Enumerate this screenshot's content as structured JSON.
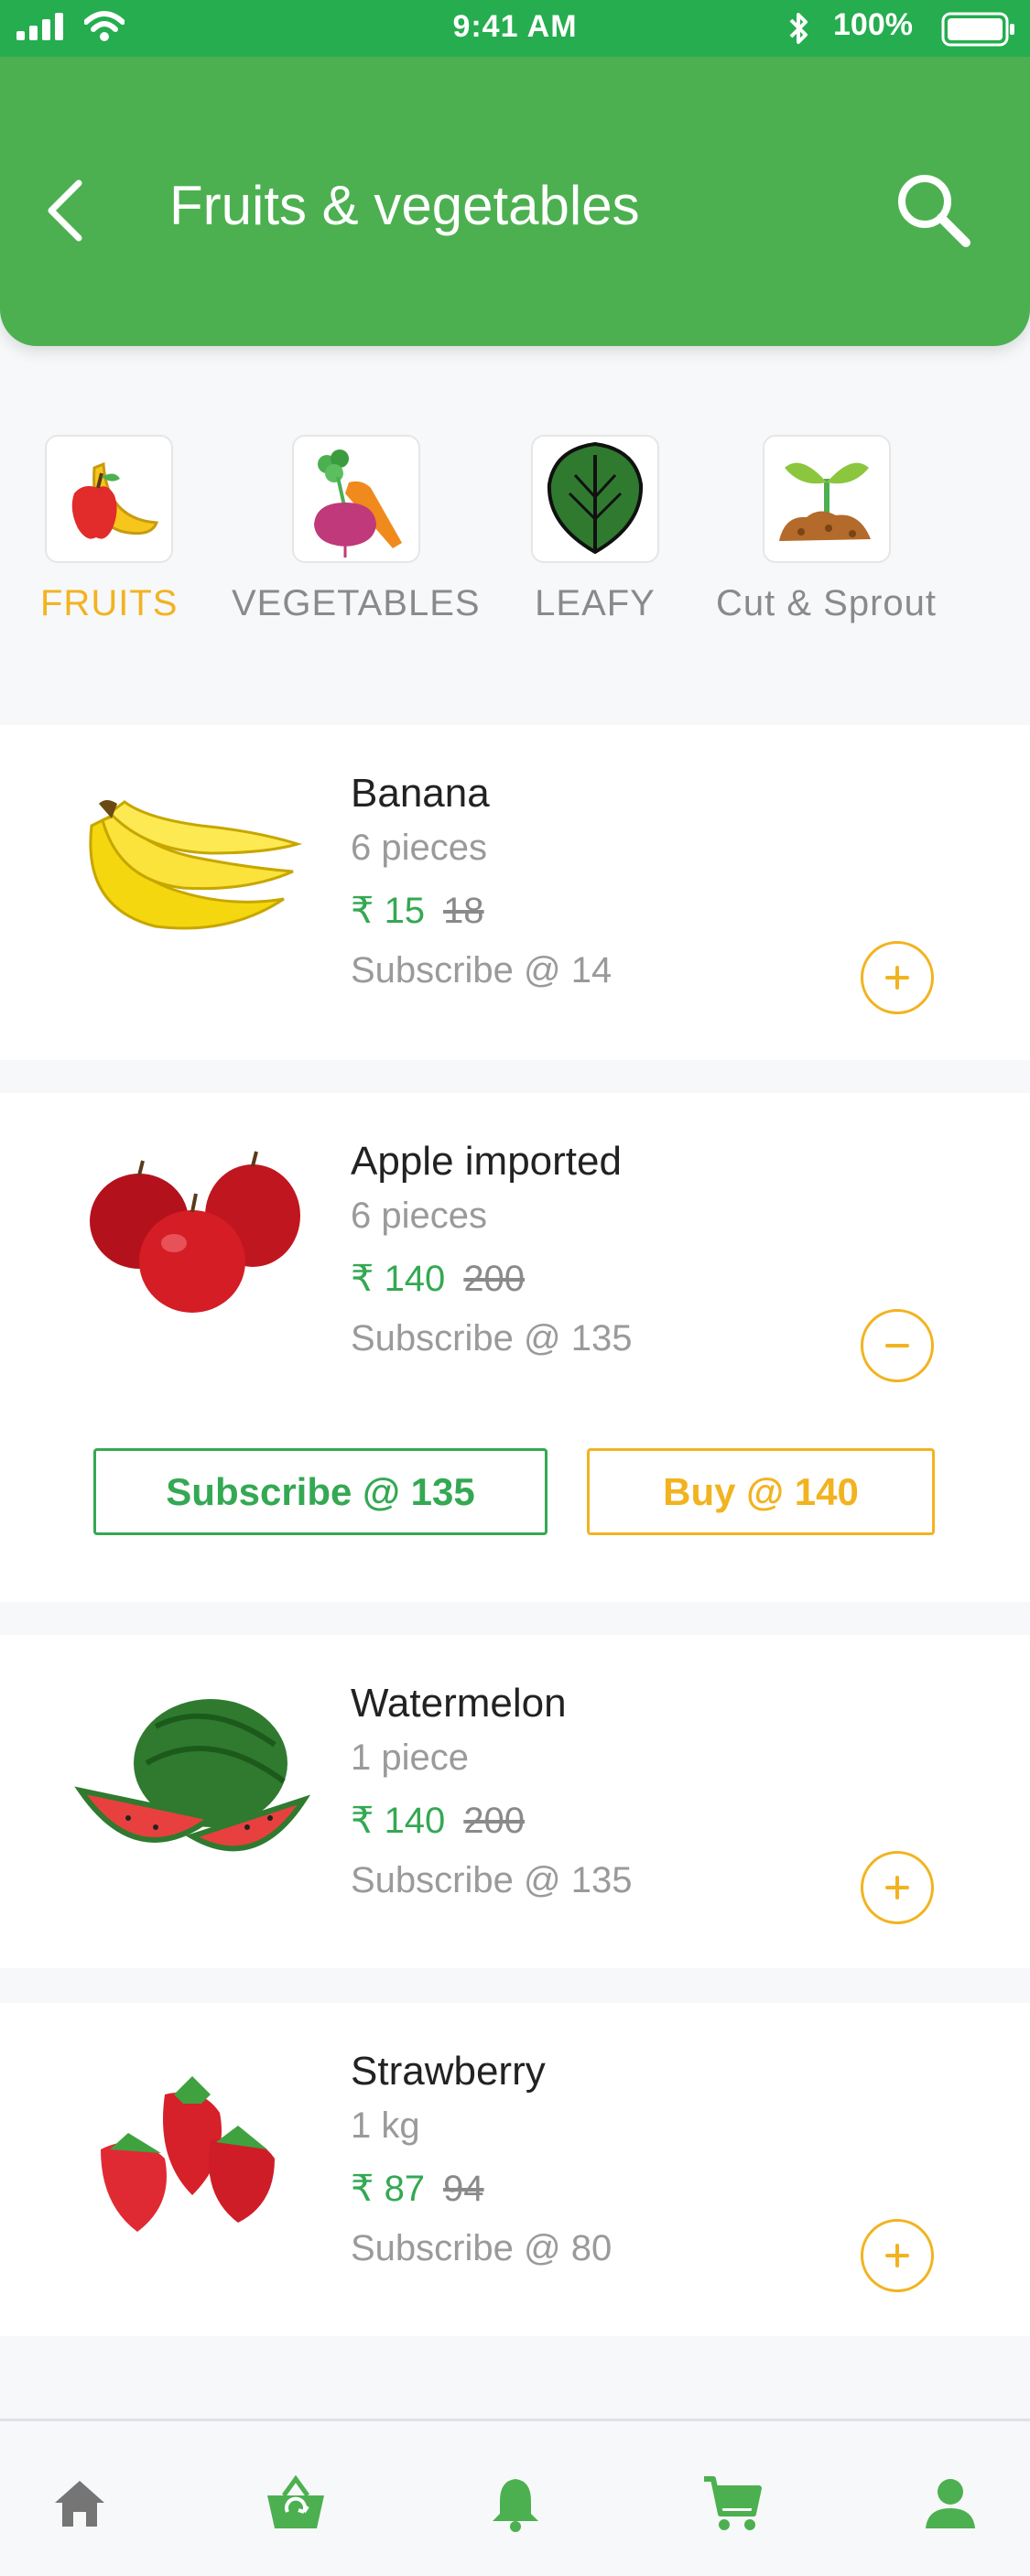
{
  "status_bar": {
    "time": "9:41 AM",
    "battery": "100%"
  },
  "header": {
    "title": "Fruits & vegetables",
    "back_icon": "chevron-left-icon",
    "search_icon": "search-icon"
  },
  "categories": [
    {
      "label": "FRUITS",
      "icon": "fruits-icon",
      "active": true
    },
    {
      "label": "VEGETABLES",
      "icon": "vegetables-icon",
      "active": false
    },
    {
      "label": "LEAFY",
      "icon": "leafy-icon",
      "active": false
    },
    {
      "label": "Cut & Sprout",
      "icon": "sprout-icon",
      "active": false
    }
  ],
  "products": [
    {
      "name": "Banana",
      "qty": "6 pieces",
      "price": "₹ 15",
      "old_price": "18",
      "subscribe": "Subscribe @ 14",
      "control": "+"
    },
    {
      "name": "Apple imported",
      "qty": "6 pieces",
      "price": "₹ 140",
      "old_price": "200",
      "subscribe": "Subscribe @ 135",
      "control": "−",
      "subscribe_button": "Subscribe @ 135",
      "buy_button": "Buy @ 140"
    },
    {
      "name": "Watermelon",
      "qty": "1 piece",
      "price": "₹ 140",
      "old_price": "200",
      "subscribe": "Subscribe @ 135",
      "control": "+"
    },
    {
      "name": "Strawberry",
      "qty": "1 kg",
      "price": "₹ 87",
      "old_price": "94",
      "subscribe": "Subscribe @ 80",
      "control": "+"
    }
  ],
  "colors": {
    "primary_green": "#4cb050",
    "accent_yellow": "#f2b320",
    "price_green": "#34a853",
    "nav_grey": "#757575"
  },
  "bottom_nav": [
    "home-icon",
    "basket-icon",
    "bell-icon",
    "cart-icon",
    "profile-icon"
  ]
}
